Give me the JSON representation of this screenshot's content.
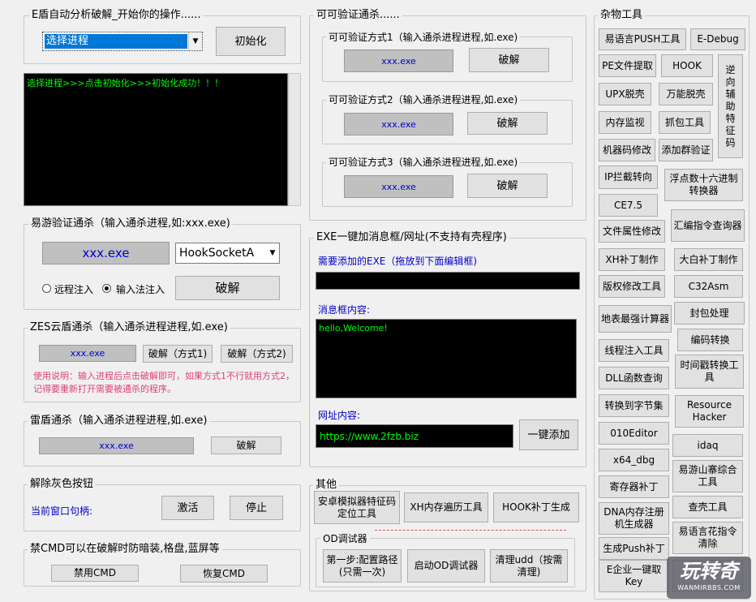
{
  "left": {
    "g1": {
      "title": "E盾自动分析破解_开始你的操作......",
      "process_select": "选择进程",
      "init_button": "初始化",
      "log_text": "选择进程>>>点击初始化>>>初始化成功！！！"
    },
    "g2": {
      "title": "易游验证通杀（输入通杀进程,如:xxx.exe)",
      "process": "xxx.exe",
      "hook_select": "HookSocketA",
      "radio_remote": "远程注入",
      "radio_input": "输入法注入",
      "crack_button": "破解"
    },
    "g3": {
      "title": "ZES云盾通杀（输入通杀进程进程,如.exe)",
      "process": "xxx.exe",
      "btn1": "破解（方式1)",
      "btn2": "破解（方式2)",
      "note": "使用说明：输入进程后点击破解即可，如果方式1不行就用方式2，记得要重新打开需要被通杀的程序。"
    },
    "g4": {
      "title": "雷盾通杀（输入通杀进程进程,如.exe)",
      "process": "xxx.exe",
      "crack_button": "破解"
    },
    "g5": {
      "title": "解除灰色按钮",
      "handle_label": "当前窗口句柄:",
      "activate": "激活",
      "stop": "停止"
    },
    "g6": {
      "title": "禁CMD可以在破解时防暗装,格盘,蓝屏等",
      "disable": "禁用CMD",
      "restore": "恢复CMD"
    }
  },
  "middle": {
    "verify": {
      "title": "可可验证通杀......",
      "methods": [
        {
          "title": "可可验证方式1（输入通杀进程进程,如.exe)",
          "process": "xxx.exe",
          "button": "破解"
        },
        {
          "title": "可可验证方式2（输入通杀进程进程,如.exe)",
          "process": "xxx.exe",
          "button": "破解"
        },
        {
          "title": "可可验证方式3（输入通杀进程进程,如.exe)",
          "process": "xxx.exe",
          "button": "破解"
        }
      ]
    },
    "exe": {
      "title": "EXE一键加消息框/网址(不支持有壳程序)",
      "exe_label": "需要添加的EXE（拖放到下面编辑框)",
      "msg_label": "消息框内容:",
      "msg_text": "hello,Welcome!",
      "url_label": "网址内容:",
      "url_text": "https://www.2fzb.biz",
      "add_button": "一键添加"
    },
    "other": {
      "title": "其他",
      "btn_android": "安卓模拟器特征码定位工具",
      "btn_xh": "XH内存遍历工具",
      "btn_hook": "HOOK补丁生成",
      "od_title": "OD调试器",
      "od_step1": "第一步:配置路径(只需一次)",
      "od_start": "启动OD调试器",
      "od_clean": "清理udd（按需清理)"
    }
  },
  "tools": {
    "title": "杂物工具",
    "buttons": {
      "b1": "易语言PUSH工具",
      "b2": "E-Debug",
      "b3": "PE文件提取",
      "b4": "HOOK",
      "b5": "逆向辅助特征码",
      "b6": "UPX脱壳",
      "b7": "万能脱壳",
      "b8": "内存监视",
      "b9": "抓包工具",
      "b10": "机器码修改",
      "b11": "添加群验证",
      "b12": "IP拦截转向",
      "b13": "浮点数十六进制转换器",
      "b14": "CE7.5",
      "b15": "文件属性修改",
      "b16": "汇编指令查询器",
      "b17": "XH补丁制作",
      "b18": "大白补丁制作",
      "b19": "版权修改工具",
      "b20": "C32Asm",
      "b21": "地表最强计算器",
      "b22": "封包处理",
      "b23": "编码转换",
      "b24": "线程注入工具",
      "b25": "时间戳转换工具",
      "b26": "DLL函数查询",
      "b27": "转换到字节集",
      "b28": "Resource Hacker",
      "b29": "010Editor",
      "b30": "idaq",
      "b31": "x64_dbg",
      "b32": "易游山寨综合工具",
      "b33": "寄存器补丁",
      "b34": "查壳工具",
      "b35": "DNA内存注册机生成器",
      "b36": "易语言花指令清除",
      "b37": "生成Push补丁",
      "b38": "E企业一键取Key"
    },
    "watermark": "玩转奇",
    "watermark_sub": "WANMIRBBS.COM"
  }
}
